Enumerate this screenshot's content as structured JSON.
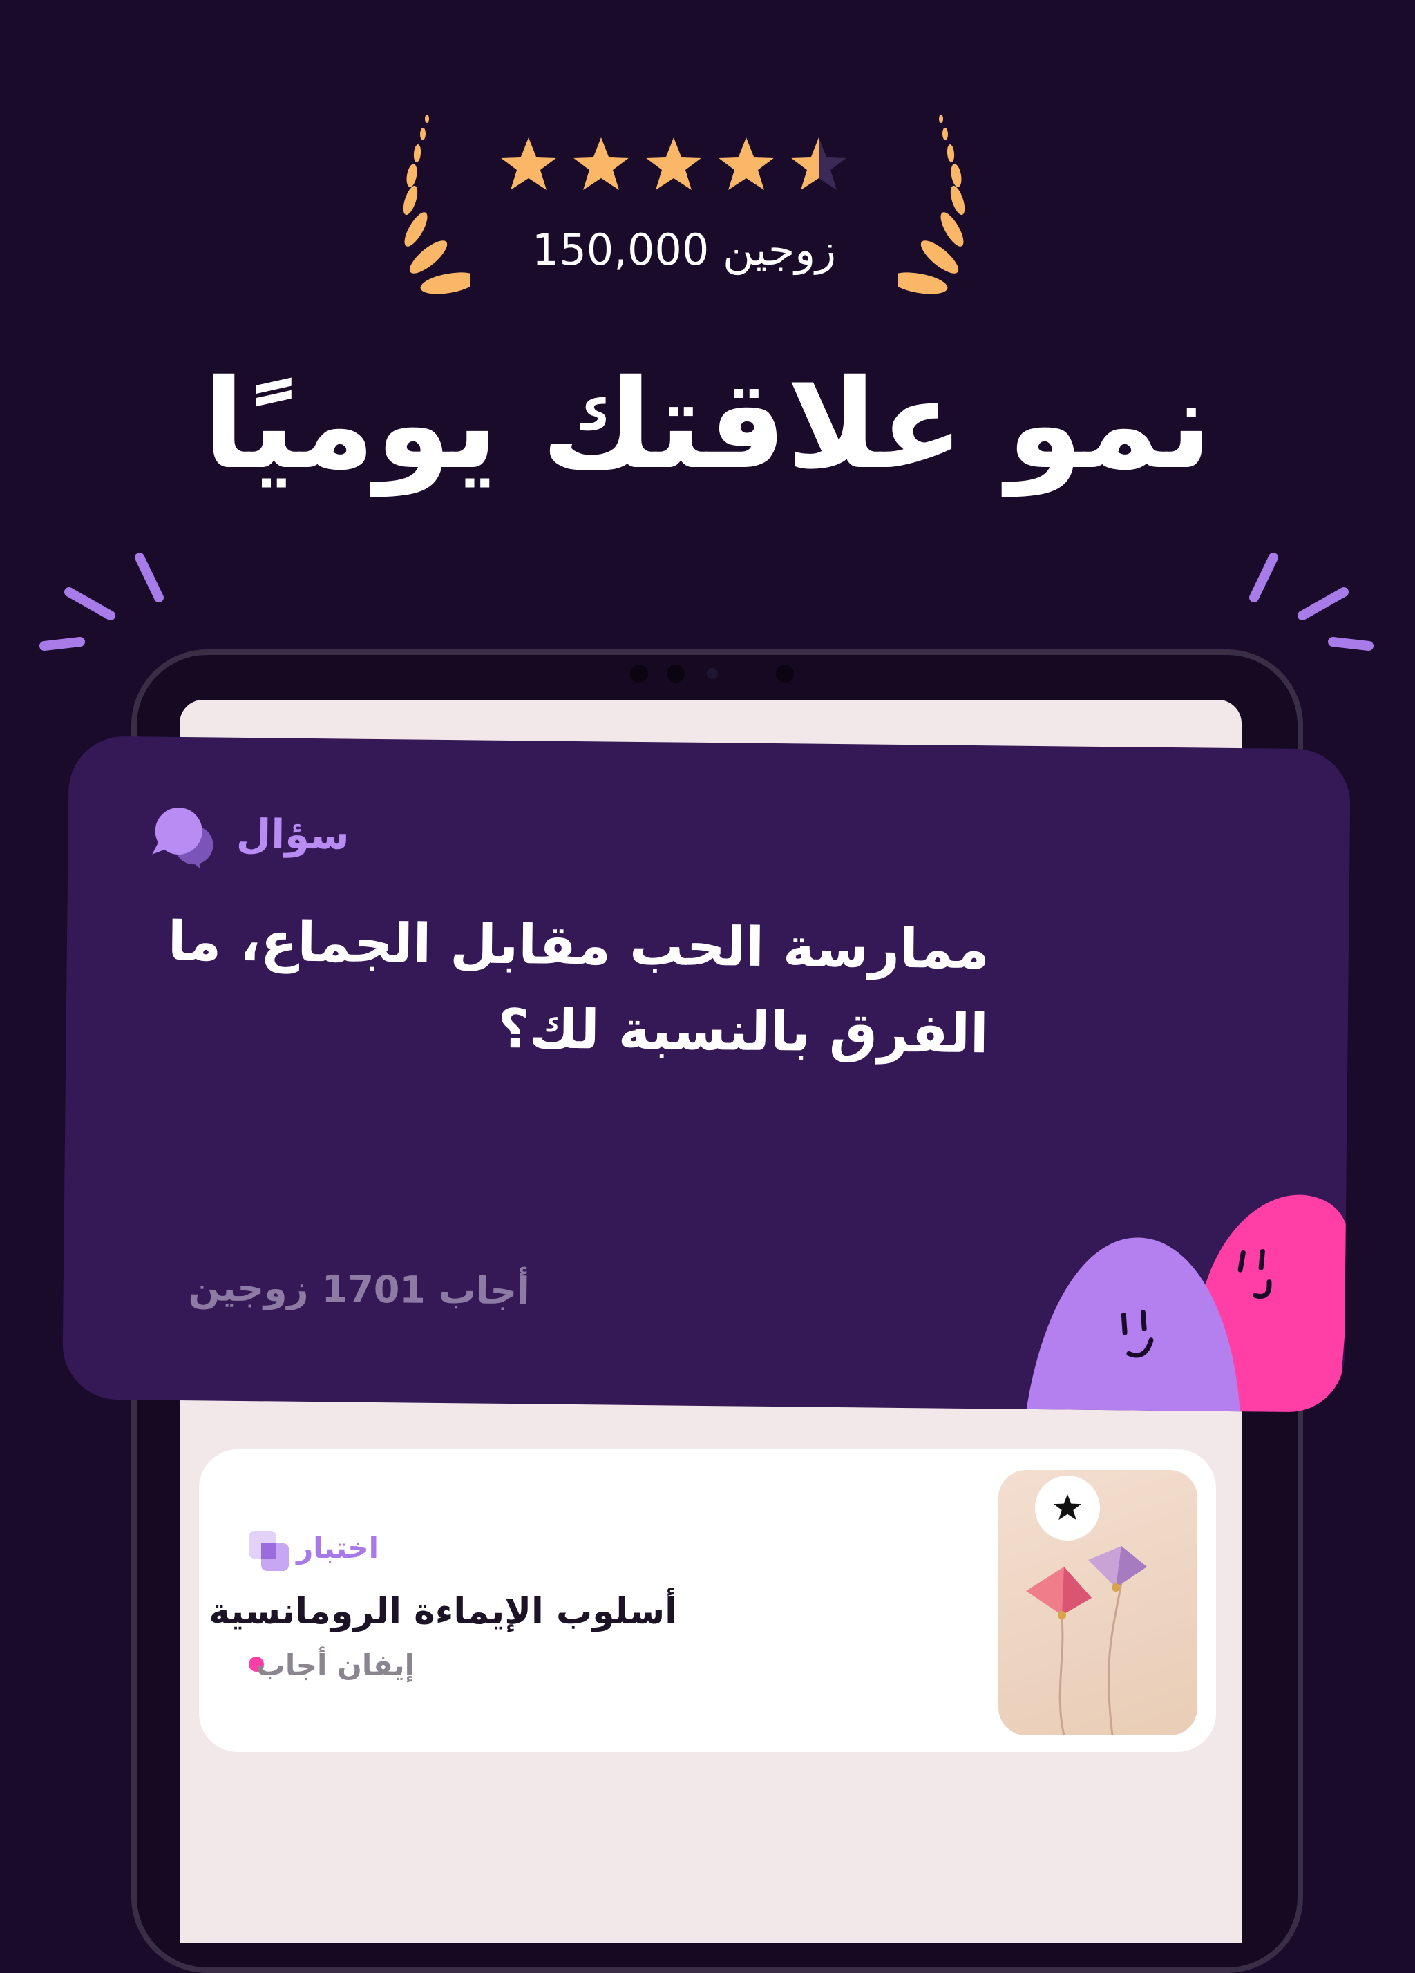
{
  "rating": {
    "stars": 4.5,
    "couples_text": "150,000 زوجين"
  },
  "headline": "نمو علاقتك يوميًا",
  "question_card": {
    "label": "سؤال",
    "title_line1": "ممارسة الحب مقابل الجماع، ما",
    "title_line2": "الفرق بالنسبة لك؟",
    "answered": "أجاب 1701 زوجين"
  },
  "quiz_card": {
    "label": "اختبار",
    "title": "أسلوب الإيماءة الرومانسية",
    "answered_by": "إيفان أجاب"
  },
  "colors": {
    "background": "#1a0b2b",
    "card": "#351957",
    "accent_purple": "#b88cf2",
    "accent_pink": "#ff3fa6",
    "star": "#fbb768"
  }
}
